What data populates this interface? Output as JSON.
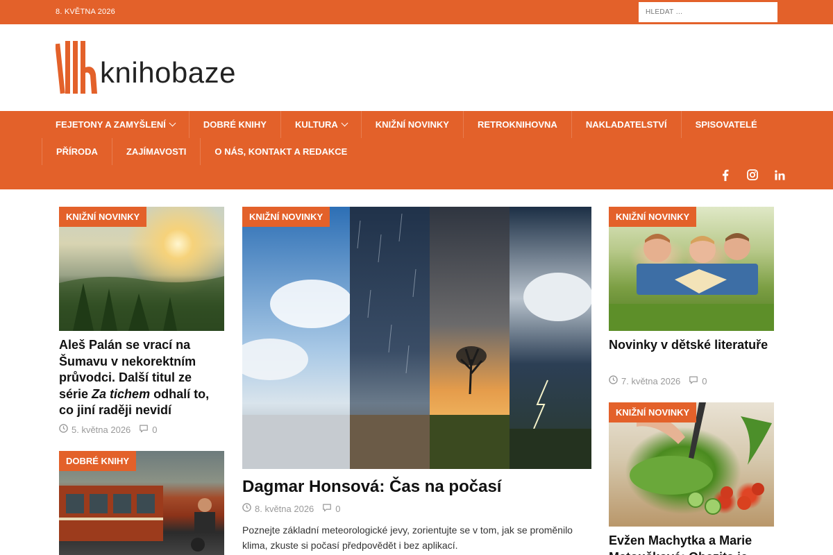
{
  "topbar": {
    "date": "8. KVĚTNA 2026",
    "search_placeholder": "HLEDAT …"
  },
  "header": {
    "logo_text": "knihobaze",
    "brand_color": "#e3612a"
  },
  "nav": {
    "row1": [
      {
        "label": "FEJETONY A ZAMYŠLENÍ",
        "has_dropdown": true
      },
      {
        "label": "DOBRÉ KNIHY",
        "has_dropdown": false
      },
      {
        "label": "KULTURA",
        "has_dropdown": true
      },
      {
        "label": "KNIŽNÍ NOVINKY",
        "has_dropdown": false
      },
      {
        "label": "RETROKNIHOVNA",
        "has_dropdown": false
      },
      {
        "label": "NAKLADATELSTVÍ",
        "has_dropdown": false
      },
      {
        "label": "SPISOVATELÉ",
        "has_dropdown": false
      }
    ],
    "row2": [
      {
        "label": "PŘÍRODA",
        "has_dropdown": false
      },
      {
        "label": "ZAJÍMAVOSTI",
        "has_dropdown": false
      },
      {
        "label": "O NÁS, KONTAKT A REDAKCE",
        "has_dropdown": false
      }
    ],
    "social": [
      "facebook-icon",
      "instagram-icon",
      "linkedin-icon"
    ]
  },
  "articles": {
    "left1": {
      "category": "KNIŽNÍ NOVINKY",
      "title_pre": "Aleš Palán se vrací na Šumavu v nekorektním průvodci. Další titul ze série ",
      "title_em": "Za tichem",
      "title_post": " odhalí to, co jiní raději nevidí",
      "date": "5. května 2026",
      "comments": "0"
    },
    "left2": {
      "category": "DOBRÉ KNIHY"
    },
    "center": {
      "category": "KNIŽNÍ NOVINKY",
      "title": "Dagmar Honsová: Čas na počasí",
      "date": "8. května 2026",
      "comments": "0",
      "excerpt": "Poznejte základní meteorologické jevy, zorientujte se v tom, jak se proměnilo klima, zkuste si počasí předpovědět i bez aplikací."
    },
    "right1": {
      "category": "KNIŽNÍ NOVINKY",
      "title": "Novinky v dětské literatuře",
      "date": "7. května 2026",
      "comments": "0"
    },
    "right2": {
      "category": "KNIŽNÍ NOVINKY",
      "title": "Evžen Machytka a Marie Matoušková: Obezita je"
    }
  }
}
